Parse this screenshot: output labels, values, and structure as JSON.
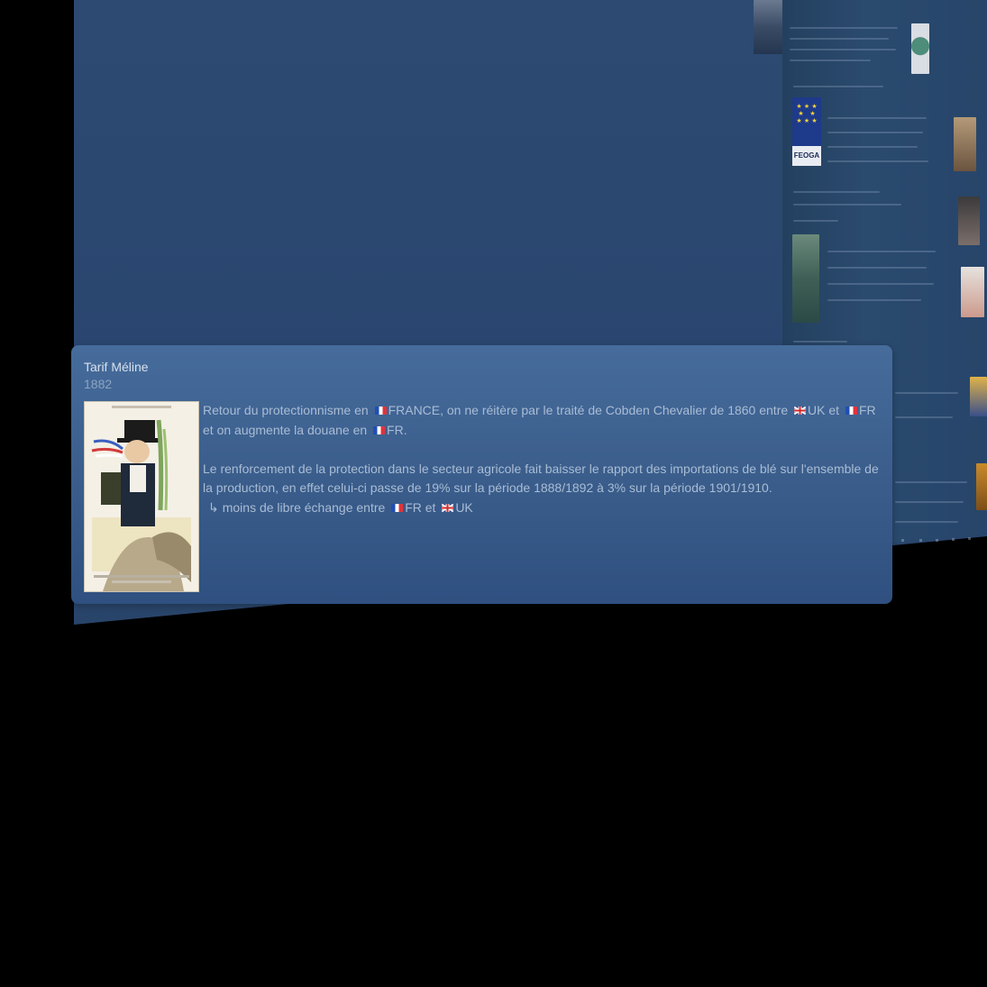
{
  "event_card": {
    "title": "Tarif Méline",
    "date": "1882",
    "image_icon": "caricature-illustration",
    "paragraph1": {
      "t1": "Retour du protectionnisme en ",
      "t2": "FRANCE, on ne réitère par le traité de Cobden Chevalier de 1860 entre ",
      "t3": "UK et ",
      "t4": "FR et on augmente la douane en ",
      "t5": "FR."
    },
    "paragraph2": {
      "text": "Le renforcement de la protection dans le secteur agricole fait baisser le rapport des importations de blé sur l'ensemble de la production, en effet celui-ci passe de 19% sur la période 1888/1892 à 3% sur la période 1901/1910.",
      "arrow": "↳",
      "t1": "moins de libre échange entre ",
      "t2": "FR et ",
      "t3": "UK"
    }
  },
  "side_panel": {
    "eu_label": "FEOGA",
    "eu_stars": "★ ★ ★\n★   ★\n★ ★ ★"
  },
  "colors": {
    "background": "#000000",
    "timeline_bg": "#2c4a72",
    "card_bg": "#3c5f8d",
    "card_text": "#a9bcd4"
  }
}
